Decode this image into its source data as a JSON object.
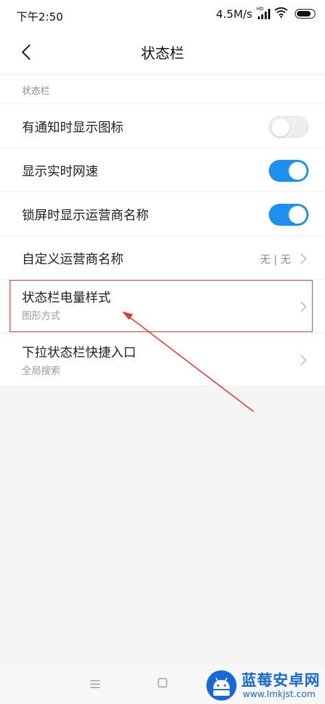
{
  "status_bar": {
    "time": "下午2:50",
    "net_speed": "4.5M/s",
    "hd_label": "HD"
  },
  "header": {
    "title": "状态栏"
  },
  "section": {
    "label": "状态栏"
  },
  "settings": [
    {
      "label": "有通知时显示图标",
      "control": "toggle",
      "on": false
    },
    {
      "label": "显示实时网速",
      "control": "toggle",
      "on": true
    },
    {
      "label": "锁屏时显示运营商名称",
      "control": "toggle",
      "on": true
    },
    {
      "label": "自定义运营商名称",
      "control": "chevron",
      "value": "无 | 无"
    },
    {
      "label": "状态栏电量样式",
      "subtitle": "图形方式",
      "control": "chevron",
      "highlighted": true
    },
    {
      "label": "下拉状态栏快捷入口",
      "subtitle": "全局搜索",
      "control": "chevron"
    }
  ],
  "annotation": {
    "color": "#e53935"
  },
  "theme": {
    "accent": "#1d8ff1"
  },
  "watermark": {
    "title": "蓝莓安卓网",
    "url": "www.lmkjst.com"
  }
}
